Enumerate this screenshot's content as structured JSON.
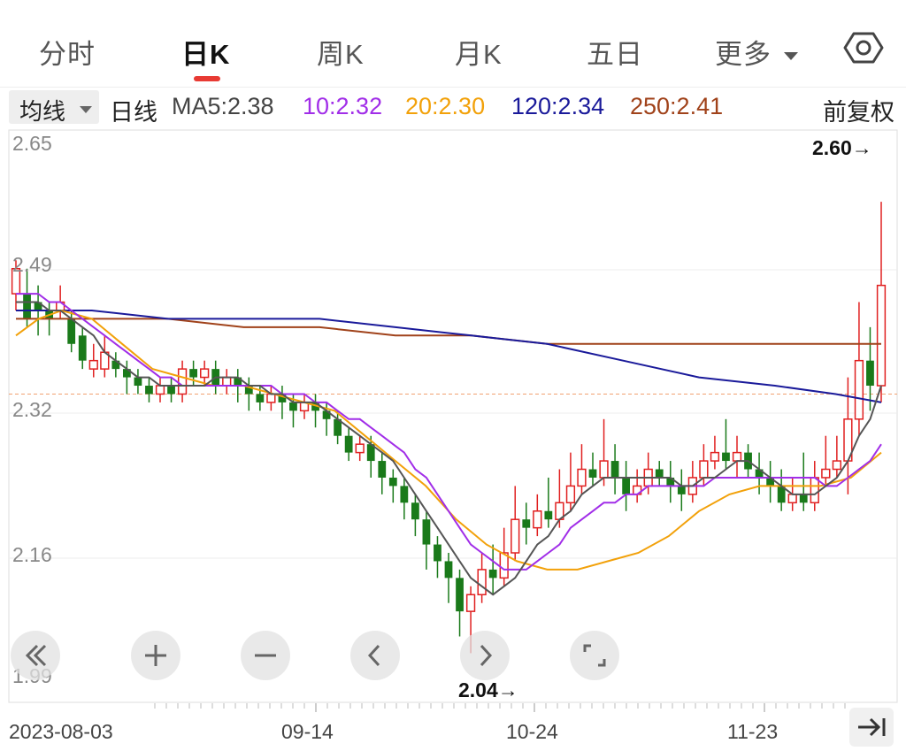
{
  "tabs": [
    "分时",
    "日K",
    "周K",
    "月K",
    "五日",
    "更多"
  ],
  "active_tab": "日K",
  "ma": {
    "selector": "均线",
    "period": "日线",
    "ma5": "MA5:2.38",
    "ma10": "10:2.32",
    "ma20": "20:2.30",
    "ma120": "120:2.34",
    "ma250": "250:2.41",
    "adjust": "前复权"
  },
  "colors": {
    "up": "#e02020",
    "down": "#1a7a1a",
    "ma5": "#555555",
    "ma10": "#a12ee8",
    "ma20": "#f2a10a",
    "ma120": "#1a1a9a",
    "ma250": "#a0421a"
  },
  "chart_data": {
    "type": "candlestick",
    "y_labels": [
      "2.65",
      "2.32",
      "2.16",
      "1.99"
    ],
    "x_labels": [
      "2023-08-03",
      "09-14",
      "10-24",
      "11-23"
    ],
    "high_marker": "2.60→",
    "low_marker": "2.04→",
    "overlay_label": "2.49",
    "reference_price": 2.35,
    "ohlc": [
      [
        2.47,
        2.5,
        2.45,
        2.51
      ],
      [
        2.47,
        2.44,
        2.43,
        2.5
      ],
      [
        2.46,
        2.45,
        2.42,
        2.48
      ],
      [
        2.45,
        2.44,
        2.42,
        2.46
      ],
      [
        2.45,
        2.46,
        2.44,
        2.48
      ],
      [
        2.44,
        2.41,
        2.4,
        2.45
      ],
      [
        2.42,
        2.39,
        2.38,
        2.43
      ],
      [
        2.38,
        2.39,
        2.37,
        2.41
      ],
      [
        2.38,
        2.4,
        2.37,
        2.42
      ],
      [
        2.39,
        2.38,
        2.37,
        2.4
      ],
      [
        2.38,
        2.37,
        2.35,
        2.39
      ],
      [
        2.37,
        2.36,
        2.35,
        2.38
      ],
      [
        2.36,
        2.35,
        2.34,
        2.37
      ],
      [
        2.35,
        2.36,
        2.34,
        2.37
      ],
      [
        2.36,
        2.35,
        2.34,
        2.37
      ],
      [
        2.35,
        2.38,
        2.34,
        2.39
      ],
      [
        2.38,
        2.37,
        2.36,
        2.39
      ],
      [
        2.37,
        2.38,
        2.36,
        2.39
      ],
      [
        2.38,
        2.36,
        2.35,
        2.39
      ],
      [
        2.36,
        2.37,
        2.35,
        2.38
      ],
      [
        2.37,
        2.36,
        2.34,
        2.38
      ],
      [
        2.36,
        2.35,
        2.33,
        2.37
      ],
      [
        2.35,
        2.34,
        2.33,
        2.36
      ],
      [
        2.34,
        2.35,
        2.33,
        2.36
      ],
      [
        2.35,
        2.34,
        2.32,
        2.36
      ],
      [
        2.34,
        2.33,
        2.31,
        2.35
      ],
      [
        2.33,
        2.34,
        2.32,
        2.35
      ],
      [
        2.34,
        2.33,
        2.31,
        2.35
      ],
      [
        2.33,
        2.32,
        2.3,
        2.34
      ],
      [
        2.32,
        2.3,
        2.29,
        2.33
      ],
      [
        2.3,
        2.28,
        2.27,
        2.31
      ],
      [
        2.28,
        2.29,
        2.27,
        2.3
      ],
      [
        2.29,
        2.27,
        2.25,
        2.3
      ],
      [
        2.27,
        2.25,
        2.23,
        2.28
      ],
      [
        2.25,
        2.24,
        2.22,
        2.26
      ],
      [
        2.24,
        2.22,
        2.2,
        2.25
      ],
      [
        2.22,
        2.2,
        2.18,
        2.23
      ],
      [
        2.2,
        2.17,
        2.14,
        2.21
      ],
      [
        2.17,
        2.15,
        2.13,
        2.18
      ],
      [
        2.15,
        2.13,
        2.1,
        2.16
      ],
      [
        2.13,
        2.09,
        2.06,
        2.14
      ],
      [
        2.09,
        2.11,
        2.04,
        2.12
      ],
      [
        2.11,
        2.14,
        2.1,
        2.16
      ],
      [
        2.14,
        2.13,
        2.11,
        2.17
      ],
      [
        2.13,
        2.16,
        2.12,
        2.19
      ],
      [
        2.16,
        2.2,
        2.15,
        2.24
      ],
      [
        2.2,
        2.19,
        2.17,
        2.22
      ],
      [
        2.19,
        2.21,
        2.18,
        2.23
      ],
      [
        2.21,
        2.2,
        2.19,
        2.25
      ],
      [
        2.2,
        2.22,
        2.19,
        2.26
      ],
      [
        2.22,
        2.24,
        2.21,
        2.28
      ],
      [
        2.24,
        2.26,
        2.23,
        2.29
      ],
      [
        2.26,
        2.25,
        2.24,
        2.28
      ],
      [
        2.25,
        2.27,
        2.24,
        2.32
      ],
      [
        2.27,
        2.25,
        2.23,
        2.29
      ],
      [
        2.25,
        2.23,
        2.21,
        2.27
      ],
      [
        2.23,
        2.24,
        2.22,
        2.26
      ],
      [
        2.24,
        2.26,
        2.23,
        2.28
      ],
      [
        2.26,
        2.25,
        2.24,
        2.27
      ],
      [
        2.25,
        2.24,
        2.22,
        2.27
      ],
      [
        2.24,
        2.23,
        2.21,
        2.26
      ],
      [
        2.23,
        2.25,
        2.22,
        2.27
      ],
      [
        2.25,
        2.27,
        2.24,
        2.29
      ],
      [
        2.27,
        2.28,
        2.26,
        2.3
      ],
      [
        2.28,
        2.27,
        2.26,
        2.32
      ],
      [
        2.27,
        2.28,
        2.25,
        2.3
      ],
      [
        2.28,
        2.26,
        2.25,
        2.29
      ],
      [
        2.26,
        2.25,
        2.23,
        2.28
      ],
      [
        2.25,
        2.24,
        2.22,
        2.27
      ],
      [
        2.24,
        2.22,
        2.21,
        2.26
      ],
      [
        2.22,
        2.23,
        2.21,
        2.25
      ],
      [
        2.23,
        2.22,
        2.21,
        2.28
      ],
      [
        2.22,
        2.25,
        2.21,
        2.27
      ],
      [
        2.25,
        2.26,
        2.24,
        2.3
      ],
      [
        2.26,
        2.27,
        2.25,
        2.3
      ],
      [
        2.27,
        2.32,
        2.23,
        2.37
      ],
      [
        2.32,
        2.39,
        2.3,
        2.46
      ],
      [
        2.39,
        2.36,
        2.33,
        2.43
      ],
      [
        2.36,
        2.48,
        2.34,
        2.58
      ]
    ],
    "ma_series": {
      "MA5": [
        2.46,
        2.46,
        2.46,
        2.45,
        2.45,
        2.44,
        2.43,
        2.42,
        2.4,
        2.39,
        2.38,
        2.37,
        2.37,
        2.36,
        2.36,
        2.36,
        2.36,
        2.36,
        2.37,
        2.37,
        2.37,
        2.36,
        2.36,
        2.35,
        2.35,
        2.34,
        2.34,
        2.34,
        2.33,
        2.32,
        2.31,
        2.3,
        2.29,
        2.28,
        2.27,
        2.25,
        2.23,
        2.21,
        2.19,
        2.17,
        2.15,
        2.13,
        2.12,
        2.11,
        2.12,
        2.13,
        2.15,
        2.17,
        2.18,
        2.2,
        2.21,
        2.23,
        2.24,
        2.25,
        2.25,
        2.25,
        2.25,
        2.25,
        2.25,
        2.25,
        2.24,
        2.24,
        2.25,
        2.25,
        2.26,
        2.27,
        2.27,
        2.26,
        2.25,
        2.24,
        2.23,
        2.23,
        2.23,
        2.24,
        2.25,
        2.27,
        2.3,
        2.32,
        2.36
      ],
      "MA10": [
        2.47,
        2.47,
        2.47,
        2.46,
        2.46,
        2.45,
        2.44,
        2.43,
        2.42,
        2.41,
        2.4,
        2.39,
        2.38,
        2.37,
        2.37,
        2.36,
        2.36,
        2.36,
        2.36,
        2.36,
        2.36,
        2.36,
        2.36,
        2.36,
        2.35,
        2.35,
        2.35,
        2.34,
        2.34,
        2.33,
        2.32,
        2.32,
        2.31,
        2.3,
        2.29,
        2.28,
        2.26,
        2.25,
        2.23,
        2.21,
        2.19,
        2.17,
        2.16,
        2.15,
        2.14,
        2.14,
        2.14,
        2.15,
        2.16,
        2.17,
        2.19,
        2.2,
        2.21,
        2.22,
        2.22,
        2.23,
        2.23,
        2.24,
        2.24,
        2.24,
        2.24,
        2.24,
        2.24,
        2.25,
        2.25,
        2.25,
        2.25,
        2.25,
        2.25,
        2.25,
        2.25,
        2.25,
        2.25,
        2.24,
        2.24,
        2.25,
        2.26,
        2.27,
        2.29
      ]
    },
    "ma20_points": [
      [
        0,
        2.42
      ],
      [
        3,
        2.44
      ],
      [
        6,
        2.45
      ],
      [
        10,
        2.44
      ],
      [
        14,
        2.41
      ],
      [
        18,
        2.38
      ],
      [
        22,
        2.37
      ],
      [
        26,
        2.36
      ],
      [
        30,
        2.36
      ],
      [
        34,
        2.35
      ],
      [
        38,
        2.34
      ],
      [
        42,
        2.33
      ],
      [
        46,
        2.3
      ],
      [
        50,
        2.27
      ],
      [
        54,
        2.24
      ],
      [
        58,
        2.2
      ],
      [
        62,
        2.17
      ],
      [
        66,
        2.15
      ],
      [
        70,
        2.14
      ],
      [
        74,
        2.14
      ],
      [
        78,
        2.15
      ],
      [
        82,
        2.16
      ],
      [
        86,
        2.18
      ],
      [
        90,
        2.21
      ],
      [
        94,
        2.23
      ],
      [
        98,
        2.24
      ],
      [
        102,
        2.24
      ],
      [
        106,
        2.24
      ],
      [
        110,
        2.25
      ],
      [
        114,
        2.28
      ]
    ],
    "ma120_points": [
      [
        0,
        2.45
      ],
      [
        10,
        2.45
      ],
      [
        20,
        2.44
      ],
      [
        30,
        2.44
      ],
      [
        40,
        2.44
      ],
      [
        50,
        2.43
      ],
      [
        60,
        2.42
      ],
      [
        70,
        2.41
      ],
      [
        80,
        2.39
      ],
      [
        90,
        2.37
      ],
      [
        100,
        2.36
      ],
      [
        108,
        2.35
      ],
      [
        114,
        2.34
      ]
    ],
    "ma250_points": [
      [
        0,
        2.44
      ],
      [
        10,
        2.44
      ],
      [
        20,
        2.44
      ],
      [
        30,
        2.43
      ],
      [
        40,
        2.43
      ],
      [
        50,
        2.42
      ],
      [
        60,
        2.42
      ],
      [
        70,
        2.41
      ],
      [
        80,
        2.41
      ],
      [
        90,
        2.41
      ],
      [
        100,
        2.41
      ],
      [
        108,
        2.41
      ],
      [
        114,
        2.41
      ]
    ]
  }
}
